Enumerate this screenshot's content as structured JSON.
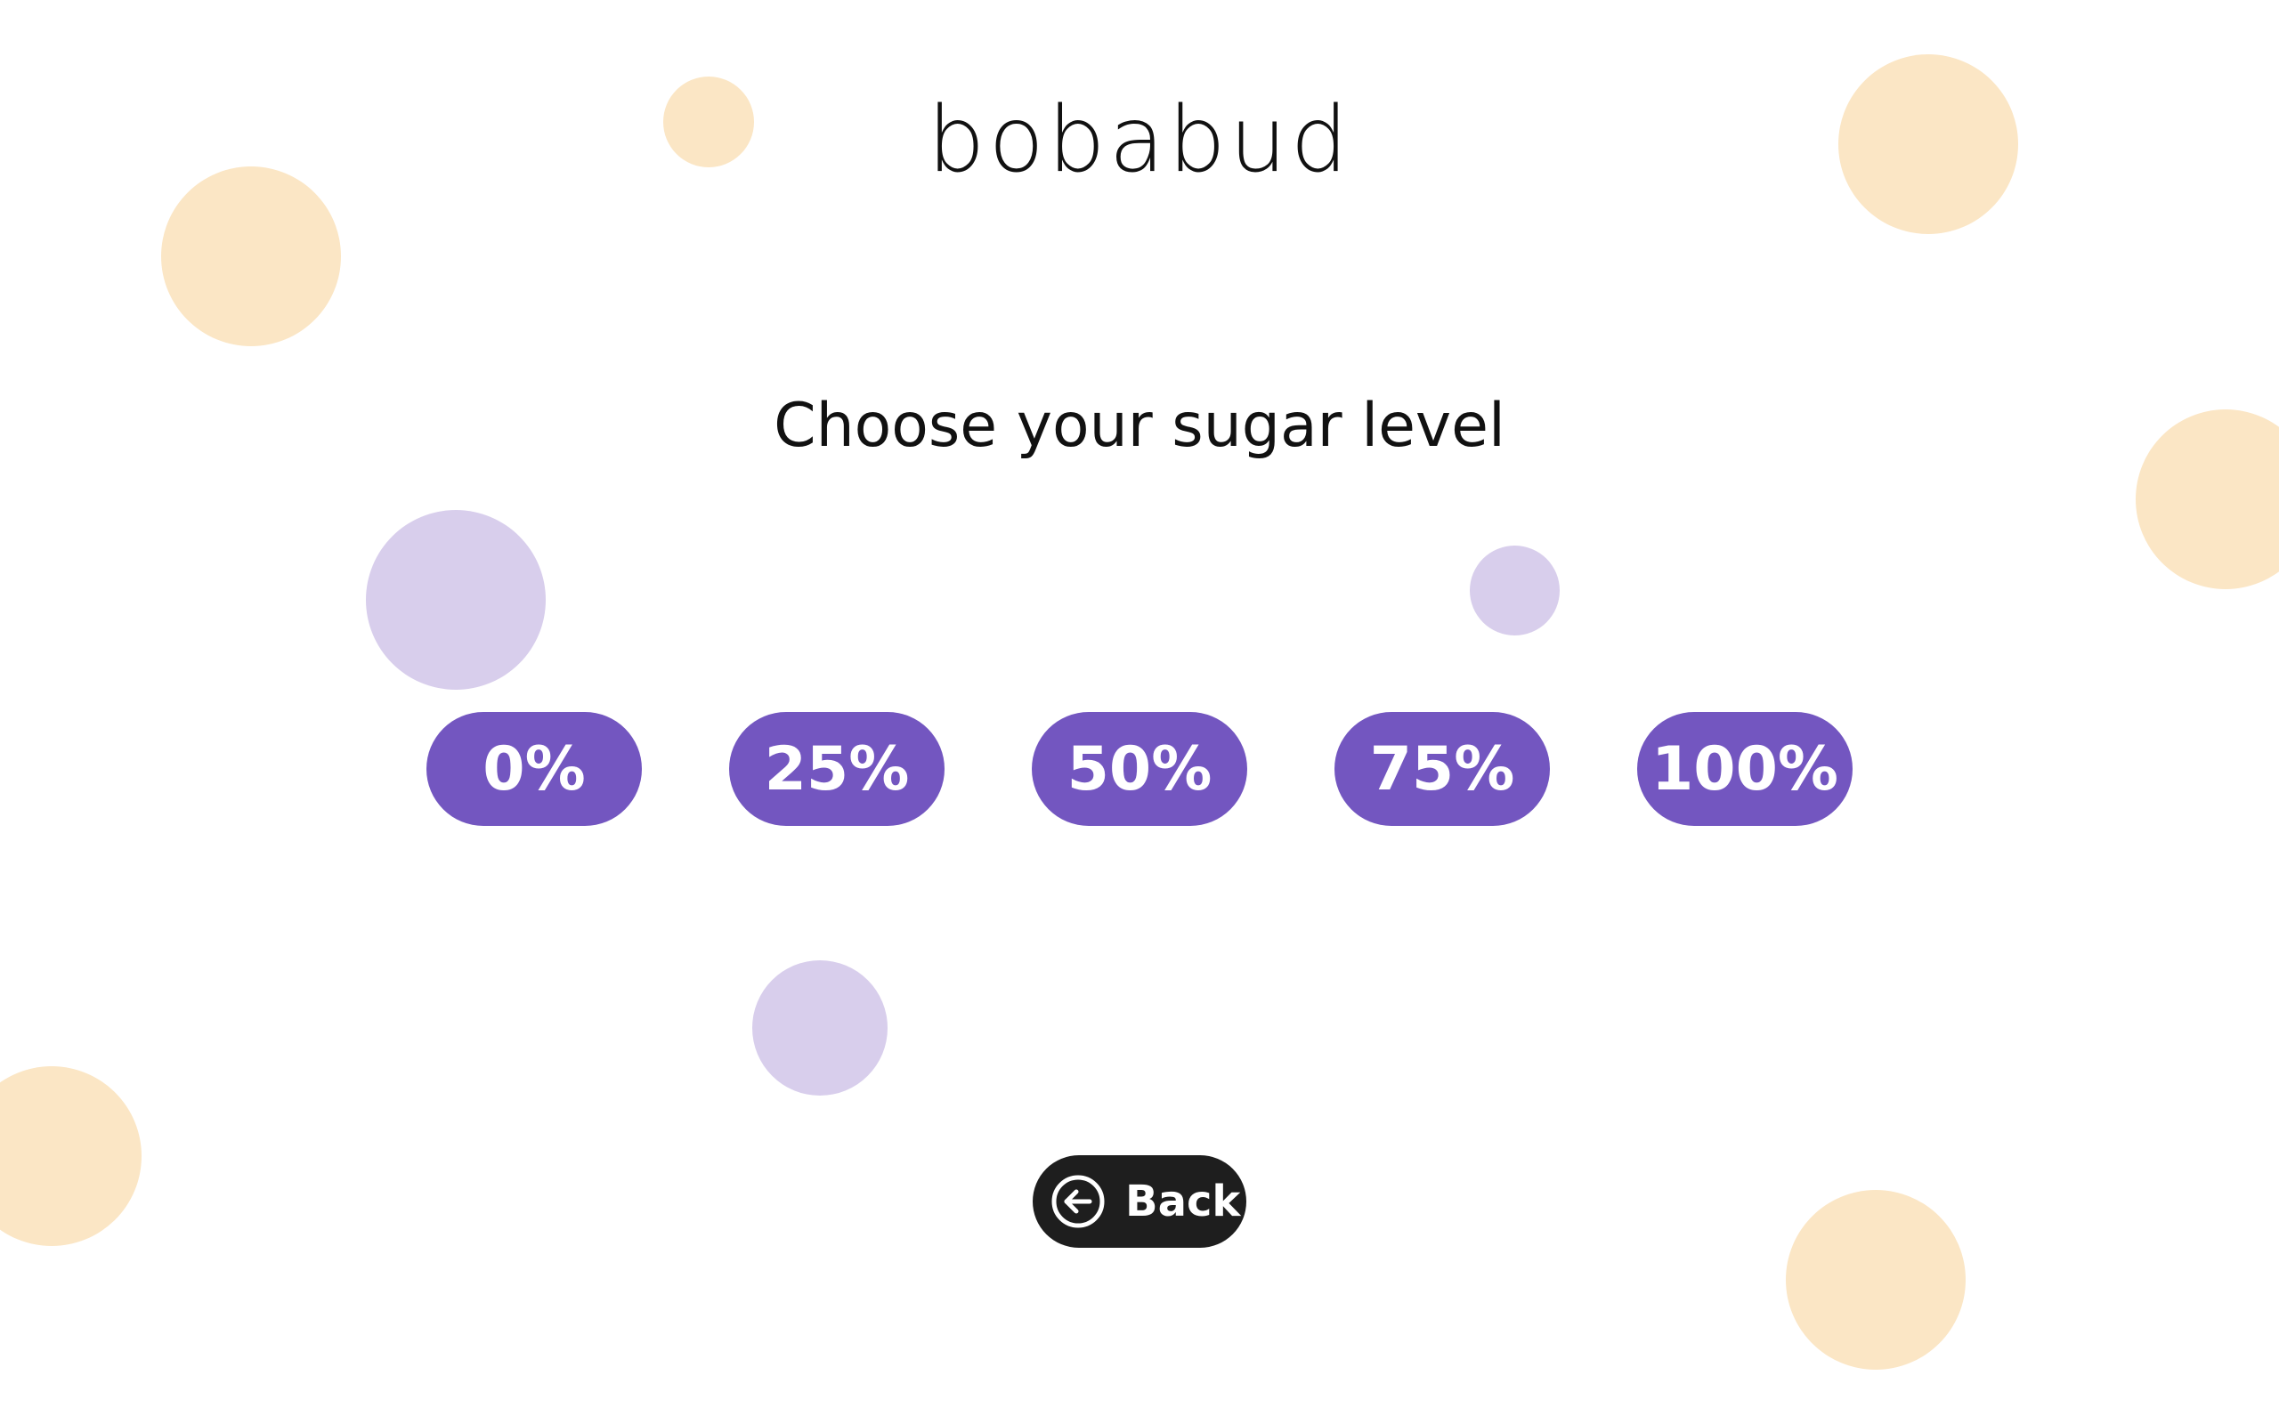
{
  "brand": {
    "logo_text": "bobabud"
  },
  "screen": {
    "title": "Choose your sugar level"
  },
  "sugar_options": [
    {
      "label": "0%",
      "value": 0
    },
    {
      "label": "25%",
      "value": 25
    },
    {
      "label": "50%",
      "value": 50
    },
    {
      "label": "75%",
      "value": 75
    },
    {
      "label": "100%",
      "value": 100
    }
  ],
  "navigation": {
    "back_label": "Back",
    "back_icon": "arrow-left-circle-icon"
  },
  "colors": {
    "option_button": "#7356c0",
    "back_button": "#1e1e1e",
    "bubble_peach": "#fbe6c5",
    "bubble_lilac": "#d8ceec"
  }
}
